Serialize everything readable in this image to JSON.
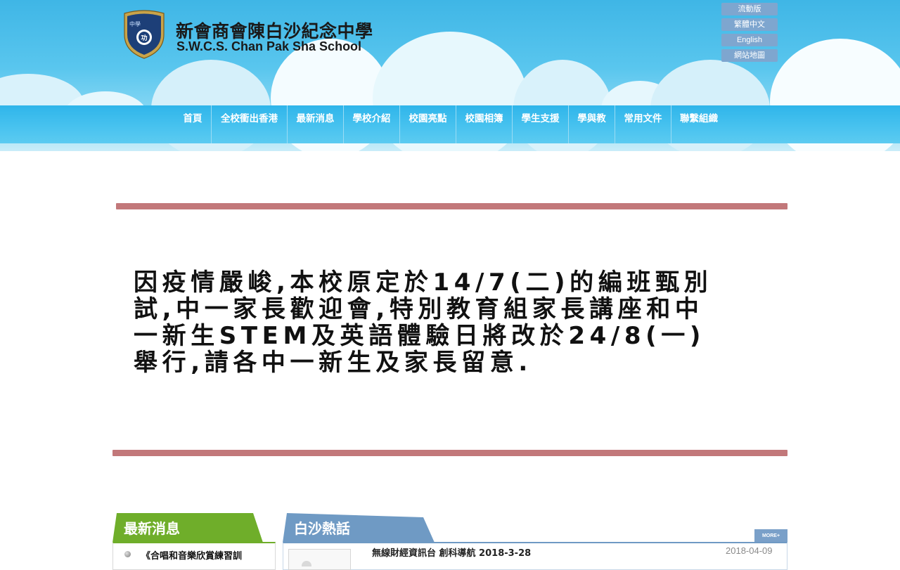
{
  "header": {
    "school_name_zh": "新會商會陳白沙紀念中學",
    "school_name_en": "S.W.C.S. Chan Pak Sha School",
    "crest_text": "中學",
    "top_links": [
      "流動版",
      "繁體中文",
      "English",
      "網站地圖"
    ]
  },
  "nav": {
    "items": [
      "首頁",
      "全校衝出香港",
      "最新消息",
      "學校介紹",
      "校園亮點",
      "校園相簿",
      "學生支援",
      "學與教",
      "常用文件",
      "聯繫組織"
    ]
  },
  "notice": {
    "line1": "因疫情嚴峻,本校原定於14/7(二)的編班甄別",
    "line2": "試,中一家長歡迎會,特別教育組家長講座和中",
    "line3": "一新生STEM及英語體驗日將改於24/8(一)",
    "line4": "舉行,請各中一新生及家長留意."
  },
  "news_panel": {
    "title": "最新消息",
    "items": [
      "《合唱和音樂欣賞練習訓"
    ]
  },
  "talk_panel": {
    "title": "白沙熱話",
    "more_label": "MORE+",
    "items": [
      {
        "title": "無線財經資訊台 創科導航 2018-3-28",
        "date": "2018-04-09"
      }
    ]
  },
  "colors": {
    "sky": "#3fb6e6",
    "nav": "#2fb5ea",
    "rule": "#c2787a",
    "news_green": "#6fae2a",
    "talk_blue": "#6f9ac4",
    "top_link_bg": "#7ea6cf"
  }
}
